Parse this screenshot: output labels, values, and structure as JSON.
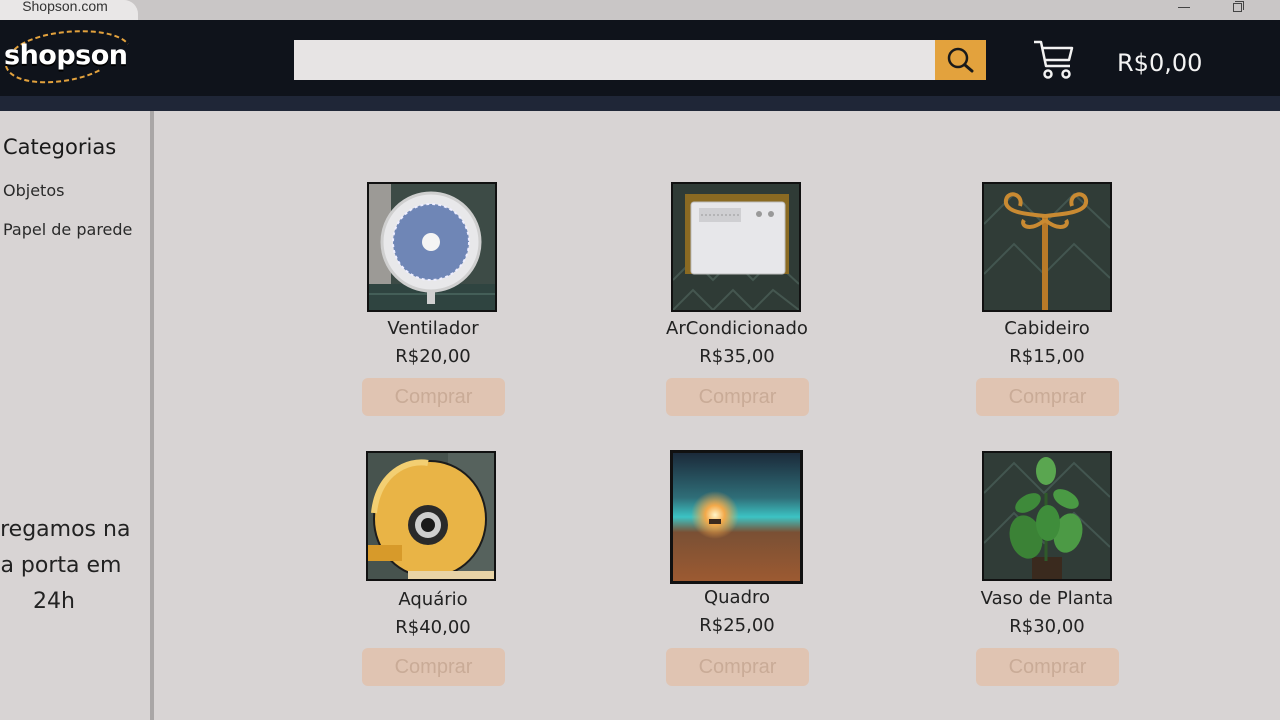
{
  "browser": {
    "tab_title": "Shopson.com"
  },
  "header": {
    "logo_text": "shopson",
    "search_placeholder": "",
    "cart_total": "R$0,00",
    "accent": "#e3a23d"
  },
  "sidebar": {
    "title": "Categorias",
    "items": [
      {
        "label": "Objetos"
      },
      {
        "label": "Papel de parede"
      }
    ],
    "promo_lines": [
      "ntregamos na",
      "ua porta em",
      "24h"
    ]
  },
  "products": [
    {
      "name": "Ventilador",
      "price": "R$20,00",
      "button": "Comprar",
      "icon": "fan"
    },
    {
      "name": "ArCondicionado",
      "price": "R$35,00",
      "button": "Comprar",
      "icon": "air-conditioner"
    },
    {
      "name": "Cabideiro",
      "price": "R$15,00",
      "button": "Comprar",
      "icon": "coat-rack"
    },
    {
      "name": "Aquário",
      "price": "R$40,00",
      "button": "Comprar",
      "icon": "aquarium"
    },
    {
      "name": "Quadro",
      "price": "R$25,00",
      "button": "Comprar",
      "icon": "painting"
    },
    {
      "name": "Vaso de Planta",
      "price": "R$30,00",
      "button": "Comprar",
      "icon": "plant-pot"
    }
  ]
}
